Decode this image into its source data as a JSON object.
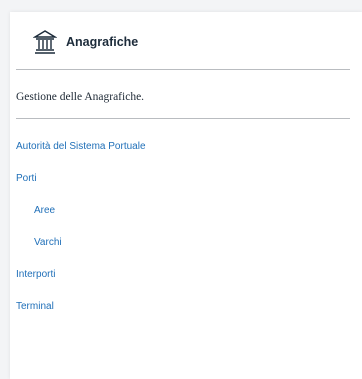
{
  "header": {
    "icon": "institution-building-icon",
    "title": "Anagrafiche"
  },
  "description": "Gestione delle Anagrafiche.",
  "nav": {
    "items": [
      {
        "label": "Autorità del Sistema Portuale",
        "level": 0
      },
      {
        "label": "Porti",
        "level": 0
      },
      {
        "label": "Aree",
        "level": 1
      },
      {
        "label": "Varchi",
        "level": 1
      },
      {
        "label": "Interporti",
        "level": 0
      },
      {
        "label": "Terminal",
        "level": 0
      }
    ]
  },
  "colors": {
    "link": "#1f6fb8",
    "title": "#1c2b3a",
    "divider": "#b9bcc0"
  }
}
